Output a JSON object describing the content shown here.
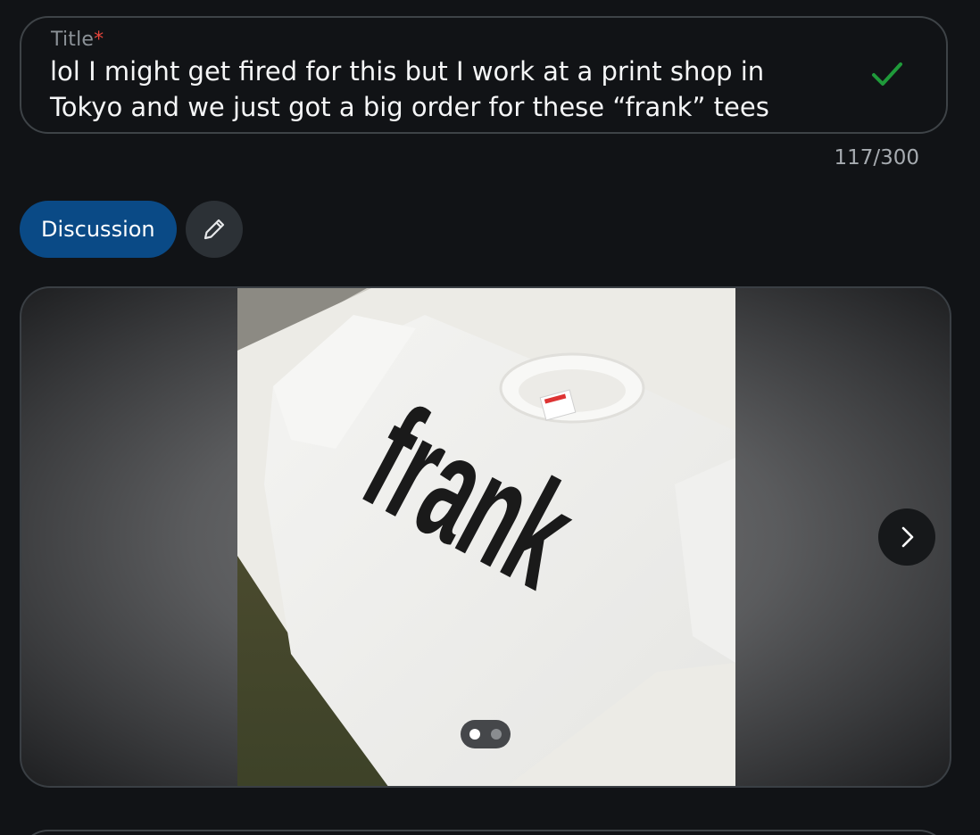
{
  "title_field": {
    "label": "Title",
    "required_marker": "*",
    "value": "lol I might get fired for this but I work at a print shop in Tokyo and we just got a big order for these “frank” tees",
    "status_icon": "check-icon",
    "status_color": "#1f9a3a"
  },
  "char_count": "117/300",
  "flair": {
    "label": "Discussion",
    "color": "#0a4a86",
    "edit_icon": "pencil-icon"
  },
  "media": {
    "photo_text": "frank",
    "next_icon": "chevron-right-icon",
    "pager": {
      "total": 2,
      "current": 1
    }
  }
}
